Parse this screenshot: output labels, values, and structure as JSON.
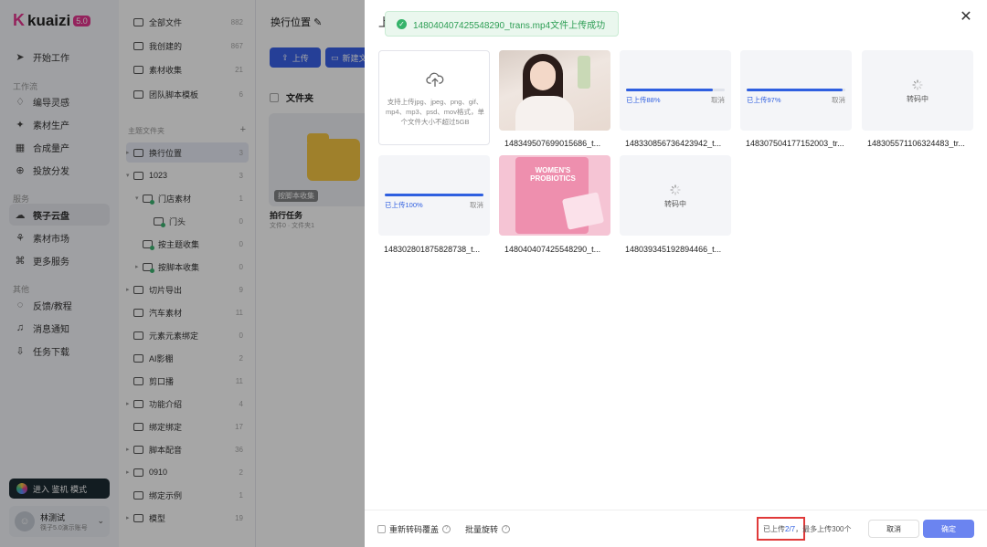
{
  "app": {
    "logo_text": "kuaizi",
    "logo_version": "5.0"
  },
  "sidebar": {
    "items": [
      {
        "label": "开始工作",
        "icon": "send-icon"
      },
      {
        "label": "编导灵感",
        "icon": "bulb-icon"
      },
      {
        "label": "素材生产",
        "icon": "sparkle-icon"
      },
      {
        "label": "合成量产",
        "icon": "grid-icon"
      },
      {
        "label": "投放分发",
        "icon": "distribute-icon"
      },
      {
        "label": "筷子云盘",
        "icon": "cloud-icon"
      },
      {
        "label": "素材市场",
        "icon": "market-icon"
      },
      {
        "label": "更多服务",
        "icon": "command-icon"
      },
      {
        "label": "反馈/教程",
        "icon": "chat-icon"
      },
      {
        "label": "消息通知",
        "icon": "bell-icon"
      },
      {
        "label": "任务下载",
        "icon": "download-icon"
      }
    ],
    "sections": [
      "工作流",
      "服务",
      "其他"
    ],
    "enter_mode": "进入 鉴机 模式",
    "user": {
      "name": "林测试",
      "sub": "筷子5.0演示账号"
    }
  },
  "tree": {
    "top": [
      {
        "label": "全部文件",
        "count": "882"
      },
      {
        "label": "我创建的",
        "count": "867"
      },
      {
        "label": "素材收集",
        "count": "21"
      },
      {
        "label": "团队脚本模板",
        "count": "6"
      }
    ],
    "section_title": "主题文件夹",
    "folders": [
      {
        "label": "换行位置",
        "count": "3"
      },
      {
        "label": "1023",
        "count": "3"
      },
      {
        "label": "门店素材",
        "count": "1"
      },
      {
        "label": "门头",
        "count": "0"
      },
      {
        "label": "按主题收集",
        "count": "0"
      },
      {
        "label": "按脚本收集",
        "count": "0"
      },
      {
        "label": "切片导出",
        "count": "9"
      },
      {
        "label": "汽车素材",
        "count": "11"
      },
      {
        "label": "元素元素绑定",
        "count": "0"
      },
      {
        "label": "AI影棚",
        "count": "2"
      },
      {
        "label": "剪口播",
        "count": "11"
      },
      {
        "label": "功能介绍",
        "count": "4"
      },
      {
        "label": "绑定绑定",
        "count": "17"
      },
      {
        "label": "脚本配音",
        "count": "36"
      },
      {
        "label": "0910",
        "count": "2"
      },
      {
        "label": "绑定示例",
        "count": "1"
      },
      {
        "label": "模型",
        "count": "19"
      }
    ]
  },
  "main": {
    "title": "换行位置",
    "upload_btn": "上传",
    "new_btn": "新建文",
    "folder_header": "文件夹",
    "folder_tag": "按脚本收集",
    "task_name": "拍行任务",
    "task_sub": "文件0 · 文件夹1"
  },
  "drawer": {
    "title": "上",
    "toast": "148040407425548290_trans.mp4文件上传成功",
    "upload_hint": "支持上传jpg、jpeg、png、gif、mp4、mp3、psd、mov格式，单个文件大小不超过5GB",
    "cancel_label": "取消",
    "transcoding_label": "转码中",
    "tiles": [
      {
        "name": "148349507699015686_t...",
        "kind": "image-woman"
      },
      {
        "name": "148330856736423942_t...",
        "kind": "progress",
        "progress_label": "已上传88%",
        "progress": 88
      },
      {
        "name": "148307504177152003_tr...",
        "kind": "progress",
        "progress_label": "已上传97%",
        "progress": 97
      },
      {
        "name": "148305571106324483_tr...",
        "kind": "transcoding"
      },
      {
        "name": "148302801875828738_t...",
        "kind": "progress",
        "progress_label": "已上传100%",
        "progress": 100
      },
      {
        "name": "148040407425548290_t...",
        "kind": "image-pink",
        "image_text": "WOMEN'S PROBIOTICS"
      },
      {
        "name": "148039345192894466_t...",
        "kind": "transcoding"
      }
    ],
    "footer": {
      "opt_recode": "重新转码覆盖",
      "opt_rotate": "批量旋转",
      "uploaded_prefix": "已上传",
      "uploaded_count": "2/7",
      "uploaded_suffix": "，最多上传300个",
      "cancel": "取消",
      "confirm": "确定"
    }
  }
}
